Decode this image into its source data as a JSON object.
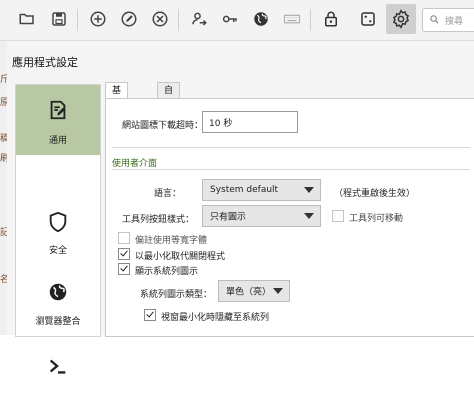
{
  "toolbar": {
    "buttons": [
      {
        "name": "open-folder-icon"
      },
      {
        "name": "save-icon"
      },
      {
        "name": "add-icon"
      },
      {
        "name": "edit-icon"
      },
      {
        "name": "delete-icon"
      },
      {
        "name": "user-transfer-icon"
      },
      {
        "name": "key-icon"
      },
      {
        "name": "globe-icon"
      },
      {
        "name": "keyboard-icon"
      },
      {
        "name": "lock-icon"
      },
      {
        "name": "dice-icon"
      },
      {
        "name": "gear-icon",
        "active": true
      }
    ],
    "search_placeholder": "搜尋"
  },
  "edge_text": [
    "斤",
    "原",
    "稿",
    "刷",
    "記",
    "名"
  ],
  "dialog": {
    "title": "應用程式設定",
    "sidebar": [
      {
        "label": "通用",
        "icon": "document-edit-icon",
        "active": true
      },
      {
        "label": "安全",
        "icon": "shield-icon"
      },
      {
        "label": "瀏覽器整合",
        "icon": "globe-icon"
      },
      {
        "label": "",
        "icon": "terminal-icon"
      }
    ],
    "tabs": [
      {
        "label": "基本設定",
        "active": true
      },
      {
        "label": "自動輸入"
      }
    ],
    "general": {
      "favicon_timeout_label": "網站圖標下載超時：",
      "favicon_timeout_value": "10 秒"
    },
    "ui_section": {
      "title": "使用者介面",
      "language_label": "語言：",
      "language_value": "System default",
      "language_note": "（程式重啟後生效）",
      "toolbar_style_label": "工具列按鈕樣式：",
      "toolbar_style_value": "只有圖示",
      "toolbar_movable_label": "工具列可移動",
      "prefer_monospace_label": "偏註使用等寬字體",
      "minimize_instead_close_label": "以最小化取代關閉程式",
      "show_tray_icon_label": "顯示系統列圖示",
      "tray_icon_type_label": "系統列圖示類型：",
      "tray_icon_type_value": "單色（亮）",
      "hide_to_tray_label": "視窗最小化時隱藏至系統列"
    }
  }
}
